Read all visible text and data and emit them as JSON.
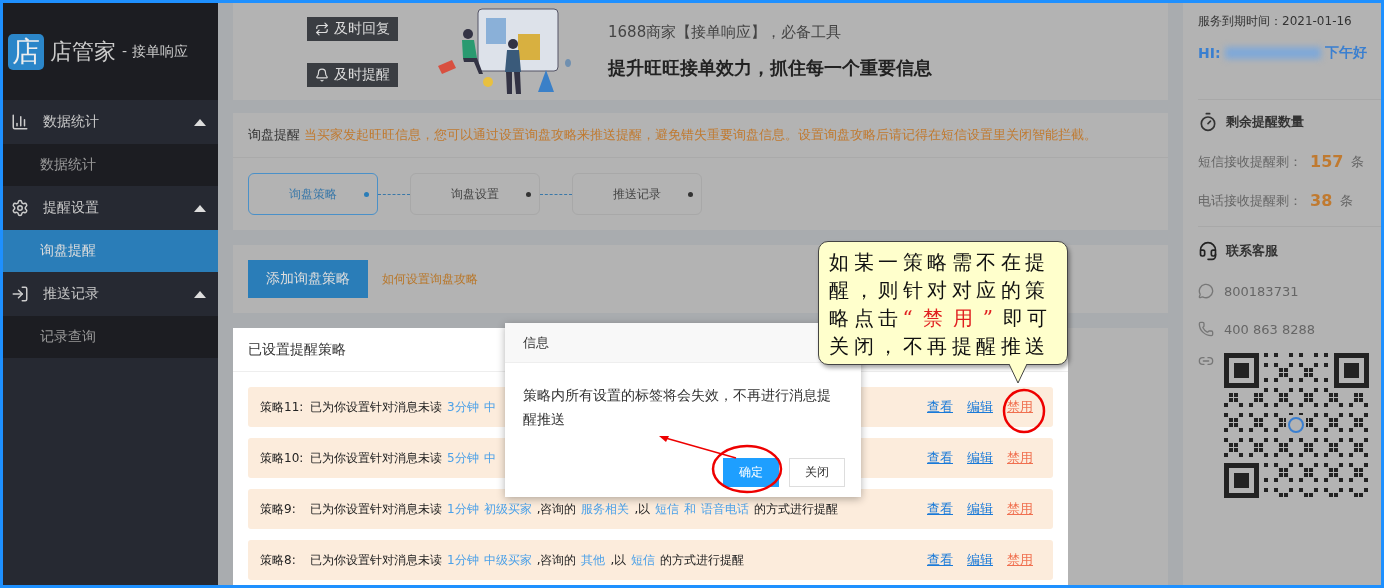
{
  "sidebar": {
    "logo": {
      "mark": "店",
      "name": "店管家",
      "subtitle": "- 接单响应"
    },
    "groups": [
      {
        "label": "数据统计",
        "expanded": true,
        "children": [
          {
            "label": "数据统计",
            "selected": false
          }
        ]
      },
      {
        "label": "提醒设置",
        "expanded": true,
        "children": [
          {
            "label": "询盘提醒",
            "selected": true
          }
        ]
      },
      {
        "label": "推送记录",
        "expanded": true,
        "children": [
          {
            "label": "记录查询",
            "selected": false
          }
        ]
      }
    ]
  },
  "banner": {
    "badges": [
      {
        "label": "及时回复"
      },
      {
        "label": "及时提醒"
      }
    ],
    "tagline": "1688商家【接单响应】，必备工具",
    "headline": "提升旺旺接单效力，抓住每一个重要信息"
  },
  "notice": {
    "label": "询盘提醒",
    "text": "当买家发起旺旺信息，您可以通过设置询盘攻略来推送提醒，避免错失重要询盘信息。设置询盘攻略后请记得在短信设置里关闭智能拦截。"
  },
  "steps": [
    {
      "label": "询盘策略",
      "selected": true
    },
    {
      "label": "询盘设置",
      "selected": false
    },
    {
      "label": "推送记录",
      "selected": false
    }
  ],
  "actions": {
    "add_button": "添加询盘策略",
    "help_link": "如何设置询盘攻略"
  },
  "strategies": {
    "title": "已设置提醒策略",
    "rows": [
      {
        "name": "策略11:",
        "segments": [
          {
            "text": "已为你设置针对消息未读",
            "kind": "plain"
          },
          {
            "text": "3分钟",
            "kind": "value"
          },
          {
            "text": "中",
            "kind": "value"
          }
        ],
        "links": [
          "查看",
          "编辑",
          "禁用"
        ]
      },
      {
        "name": "策略10:",
        "segments": [
          {
            "text": "已为你设置针对消息未读",
            "kind": "plain"
          },
          {
            "text": "5分钟",
            "kind": "value"
          },
          {
            "text": "中",
            "kind": "value"
          }
        ],
        "links": [
          "查看",
          "编辑",
          "禁用"
        ]
      },
      {
        "name": "策略9:",
        "segments": [
          {
            "text": "已为你设置针对消息未读",
            "kind": "plain"
          },
          {
            "text": "1分钟",
            "kind": "value"
          },
          {
            "text": "初级买家",
            "kind": "value"
          },
          {
            "text": ",咨询的",
            "kind": "plain"
          },
          {
            "text": "服务相关",
            "kind": "value"
          },
          {
            "text": ",以",
            "kind": "plain"
          },
          {
            "text": "短信",
            "kind": "value"
          },
          {
            "text": "和",
            "kind": "value"
          },
          {
            "text": "语音电话",
            "kind": "value"
          },
          {
            "text": "的方式进行提醒",
            "kind": "plain"
          }
        ],
        "links": [
          "查看",
          "编辑",
          "禁用"
        ]
      },
      {
        "name": "策略8:",
        "segments": [
          {
            "text": "已为你设置针对消息未读",
            "kind": "plain"
          },
          {
            "text": "1分钟",
            "kind": "value"
          },
          {
            "text": "中级买家",
            "kind": "value"
          },
          {
            "text": ",咨询的",
            "kind": "plain"
          },
          {
            "text": "其他",
            "kind": "value"
          },
          {
            "text": ",以",
            "kind": "plain"
          },
          {
            "text": "短信",
            "kind": "value"
          },
          {
            "text": "的方式进行提醒",
            "kind": "plain"
          }
        ],
        "links": [
          "查看",
          "编辑",
          "禁用"
        ]
      }
    ]
  },
  "dialog": {
    "title": "信息",
    "message": "策略内所有设置的标签将会失效，不再进行消息提醒推送",
    "buttons": [
      {
        "label": "确定",
        "kind": "primary"
      },
      {
        "label": "关闭",
        "kind": "secondary"
      }
    ]
  },
  "callout": {
    "segments": [
      {
        "text": "如某一策略需不在提醒，则针对对应的策略点击",
        "kind": "plain"
      },
      {
        "text": "“禁用”",
        "kind": "emphasis"
      },
      {
        "text": "即可关闭，不再提醒推送",
        "kind": "plain"
      }
    ]
  },
  "account": {
    "expiry": "服务到期时间：2021-01-16",
    "greeting_prefix": "HI:",
    "greeting_suffix": "下午好"
  },
  "quota": {
    "title": "剩余提醒数量",
    "items": [
      {
        "label": "短信接收提醒剩：",
        "count": "157",
        "unit": "条"
      },
      {
        "label": "电话接收提醒剩：",
        "count": "38",
        "unit": "条"
      }
    ]
  },
  "support": {
    "title": "联系客服",
    "contacts": [
      {
        "kind": "qq",
        "value": "800183731"
      },
      {
        "kind": "phone",
        "value": "400 863 8288"
      }
    ]
  }
}
